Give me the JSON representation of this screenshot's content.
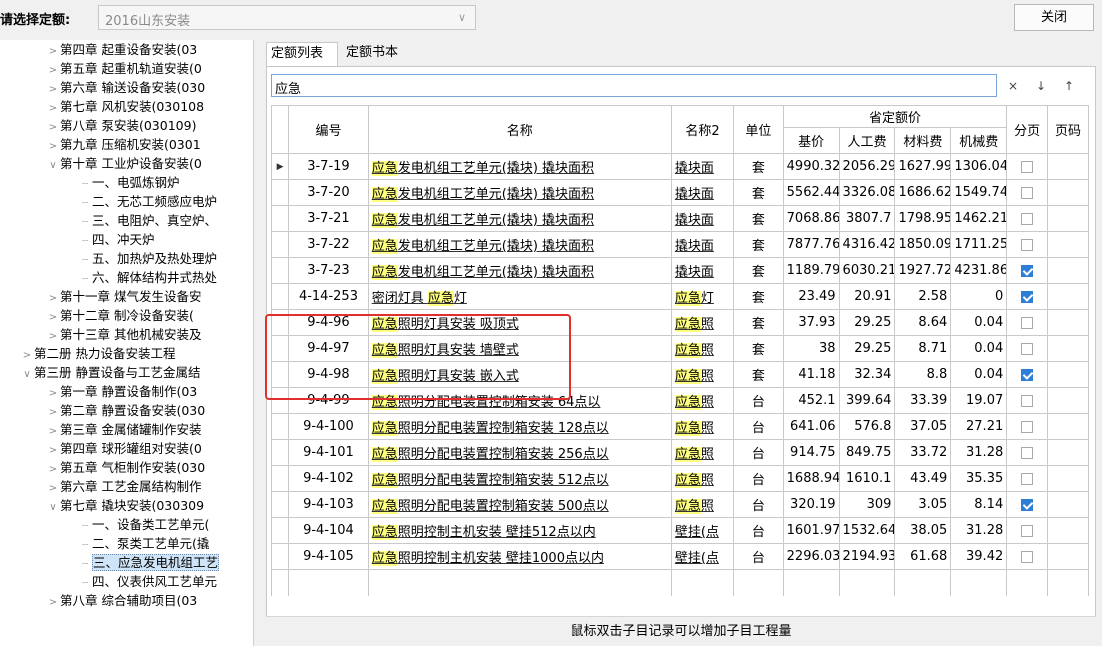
{
  "topbar": {
    "label": "请选择定额:",
    "quota_value": "2016山东安装",
    "close_label": "关闭"
  },
  "tree": {
    "items": [
      {
        "level": 1,
        "arrow": ">",
        "text": "第四章 起重设备安装(03"
      },
      {
        "level": 1,
        "arrow": ">",
        "text": "第五章 起重机轨道安装(0"
      },
      {
        "level": 1,
        "arrow": ">",
        "text": "第六章 输送设备安装(030"
      },
      {
        "level": 1,
        "arrow": ">",
        "text": "第七章 风机安装(030108"
      },
      {
        "level": 1,
        "arrow": ">",
        "text": "第八章 泵安装(030109)"
      },
      {
        "level": 1,
        "arrow": ">",
        "text": "第九章 压缩机安装(0301"
      },
      {
        "level": 1,
        "arrow": "∨",
        "text": "第十章 工业炉设备安装(0"
      },
      {
        "level": 2,
        "arrow": "",
        "text": "一、电弧炼钢炉"
      },
      {
        "level": 2,
        "arrow": "",
        "text": "二、无芯工频感应电炉"
      },
      {
        "level": 2,
        "arrow": "",
        "text": "三、电阻炉、真空炉、"
      },
      {
        "level": 2,
        "arrow": "",
        "text": "四、冲天炉"
      },
      {
        "level": 2,
        "arrow": "",
        "text": "五、加热炉及热处理炉"
      },
      {
        "level": 2,
        "arrow": "",
        "text": "六、解体结构井式热处"
      },
      {
        "level": 1,
        "arrow": ">",
        "text": "第十一章 煤气发生设备安"
      },
      {
        "level": 1,
        "arrow": ">",
        "text": "第十二章 制冷设备安装("
      },
      {
        "level": 1,
        "arrow": ">",
        "text": "第十三章 其他机械安装及"
      },
      {
        "level": 0,
        "arrow": ">",
        "text": "第二册 热力设备安装工程"
      },
      {
        "level": 0,
        "arrow": "∨",
        "text": "第三册 静置设备与工艺金属结"
      },
      {
        "level": 1,
        "arrow": ">",
        "text": "第一章 静置设备制作(03"
      },
      {
        "level": 1,
        "arrow": ">",
        "text": "第二章 静置设备安装(030"
      },
      {
        "level": 1,
        "arrow": ">",
        "text": "第三章 金属储罐制作安装"
      },
      {
        "level": 1,
        "arrow": ">",
        "text": "第四章 球形罐组对安装(0"
      },
      {
        "level": 1,
        "arrow": ">",
        "text": "第五章 气柜制作安装(030"
      },
      {
        "level": 1,
        "arrow": ">",
        "text": "第六章 工艺金属结构制作"
      },
      {
        "level": 1,
        "arrow": "∨",
        "text": "第七章 撬块安装(030309"
      },
      {
        "level": 2,
        "arrow": "",
        "text": "一、设备类工艺单元("
      },
      {
        "level": 2,
        "arrow": "",
        "text": "二、泵类工艺单元(撬"
      },
      {
        "level": 2,
        "arrow": "",
        "text": "三、应急发电机组工艺",
        "selected": true
      },
      {
        "level": 2,
        "arrow": "",
        "text": "四、仪表供风工艺单元"
      },
      {
        "level": 1,
        "arrow": ">",
        "text": "第八章 综合辅助项目(03"
      }
    ]
  },
  "tabs": {
    "list": "定额列表",
    "book": "定额书本"
  },
  "search": {
    "query": "应急",
    "clear_icon": "×",
    "down_icon": "↓",
    "up_icon": "↑"
  },
  "table": {
    "headers": {
      "code": "编号",
      "name": "名称",
      "name2": "名称2",
      "unit": "单位",
      "price_group": "省定额价",
      "base": "基价",
      "labor": "人工费",
      "material": "材料费",
      "machine": "机械费",
      "page_break": "分页",
      "page_no": "页码"
    },
    "highlight_term": "应急",
    "rows": [
      {
        "code": "3-7-19",
        "name_hl": "应急",
        "name_rest": "发电机组工艺单元(撬块) 撬块面积",
        "name2_hl": "",
        "name2_rest": "撬块面",
        "unit": "套",
        "base": "4990.32",
        "labor": "2056.29",
        "material": "1627.99",
        "machine": "1306.04",
        "page_break": false,
        "current": true
      },
      {
        "code": "3-7-20",
        "name_hl": "应急",
        "name_rest": "发电机组工艺单元(撬块) 撬块面积",
        "name2_hl": "",
        "name2_rest": "撬块面",
        "unit": "套",
        "base": "5562.44",
        "labor": "3326.08",
        "material": "1686.62",
        "machine": "1549.74",
        "page_break": false
      },
      {
        "code": "3-7-21",
        "name_hl": "应急",
        "name_rest": "发电机组工艺单元(撬块) 撬块面积",
        "name2_hl": "",
        "name2_rest": "撬块面",
        "unit": "套",
        "base": "7068.86",
        "labor": "3807.7",
        "material": "1798.95",
        "machine": "1462.21",
        "page_break": false
      },
      {
        "code": "3-7-22",
        "name_hl": "应急",
        "name_rest": "发电机组工艺单元(撬块) 撬块面积",
        "name2_hl": "",
        "name2_rest": "撬块面",
        "unit": "套",
        "base": "7877.76",
        "labor": "4316.42",
        "material": "1850.09",
        "machine": "1711.25",
        "page_break": false
      },
      {
        "code": "3-7-23",
        "name_hl": "应急",
        "name_rest": "发电机组工艺单元(撬块) 撬块面积",
        "name2_hl": "",
        "name2_rest": "撬块面",
        "unit": "套",
        "base": "1189.79",
        "labor": "6030.21",
        "material": "1927.72",
        "machine": "4231.86",
        "page_break": true
      },
      {
        "code": "4-14-253",
        "name_pre": "密闭灯具 ",
        "name_hl": "应急",
        "name_rest": "灯",
        "name2_hl": "应急",
        "name2_rest": "灯",
        "unit": "套",
        "base": "23.49",
        "labor": "20.91",
        "material": "2.58",
        "machine": "0",
        "page_break": true
      },
      {
        "code": "9-4-96",
        "name_hl": "应急",
        "name_rest": "照明灯具安装 吸顶式",
        "name2_hl": "应急",
        "name2_rest": "照",
        "unit": "套",
        "base": "37.93",
        "labor": "29.25",
        "material": "8.64",
        "machine": "0.04",
        "page_break": false
      },
      {
        "code": "9-4-97",
        "name_hl": "应急",
        "name_rest": "照明灯具安装 墙壁式",
        "name2_hl": "应急",
        "name2_rest": "照",
        "unit": "套",
        "base": "38",
        "labor": "29.25",
        "material": "8.71",
        "machine": "0.04",
        "page_break": false
      },
      {
        "code": "9-4-98",
        "name_hl": "应急",
        "name_rest": "照明灯具安装 嵌入式",
        "name2_hl": "应急",
        "name2_rest": "照",
        "unit": "套",
        "base": "41.18",
        "labor": "32.34",
        "material": "8.8",
        "machine": "0.04",
        "page_break": true
      },
      {
        "code": "9-4-99",
        "name_hl": "应急",
        "name_rest": "照明分配电装置控制箱安装 64点以",
        "name2_hl": "应急",
        "name2_rest": "照",
        "unit": "台",
        "base": "452.1",
        "labor": "399.64",
        "material": "33.39",
        "machine": "19.07",
        "page_break": false
      },
      {
        "code": "9-4-100",
        "name_hl": "应急",
        "name_rest": "照明分配电装置控制箱安装 128点以",
        "name2_hl": "应急",
        "name2_rest": "照",
        "unit": "台",
        "base": "641.06",
        "labor": "576.8",
        "material": "37.05",
        "machine": "27.21",
        "page_break": false
      },
      {
        "code": "9-4-101",
        "name_hl": "应急",
        "name_rest": "照明分配电装置控制箱安装 256点以",
        "name2_hl": "应急",
        "name2_rest": "照",
        "unit": "台",
        "base": "914.75",
        "labor": "849.75",
        "material": "33.72",
        "machine": "31.28",
        "page_break": false
      },
      {
        "code": "9-4-102",
        "name_hl": "应急",
        "name_rest": "照明分配电装置控制箱安装 512点以",
        "name2_hl": "应急",
        "name2_rest": "照",
        "unit": "台",
        "base": "1688.94",
        "labor": "1610.1",
        "material": "43.49",
        "machine": "35.35",
        "page_break": false
      },
      {
        "code": "9-4-103",
        "name_hl": "应急",
        "name_rest": "照明分配电装置控制箱安装 500点以",
        "name2_hl": "应急",
        "name2_rest": "照",
        "unit": "台",
        "base": "320.19",
        "labor": "309",
        "material": "3.05",
        "machine": "8.14",
        "page_break": true
      },
      {
        "code": "9-4-104",
        "name_hl": "应急",
        "name_rest": "照明控制主机安装 壁挂512点以内",
        "name2_hl": "",
        "name2_rest": "壁挂(点",
        "unit": "台",
        "base": "1601.97",
        "labor": "1532.64",
        "material": "38.05",
        "machine": "31.28",
        "page_break": false
      },
      {
        "code": "9-4-105",
        "name_hl": "应急",
        "name_rest": "照明控制主机安装 壁挂1000点以内",
        "name2_hl": "",
        "name2_rest": "壁挂(点",
        "unit": "台",
        "base": "2296.03",
        "labor": "2194.93",
        "material": "61.68",
        "machine": "39.42",
        "page_break": false
      }
    ]
  },
  "status": "鼠标双击子目记录可以增加子目工程量",
  "colors": {
    "highlight": "#ffff80",
    "annotation_box": "#e0302c",
    "checked": "#2d7fd6"
  }
}
